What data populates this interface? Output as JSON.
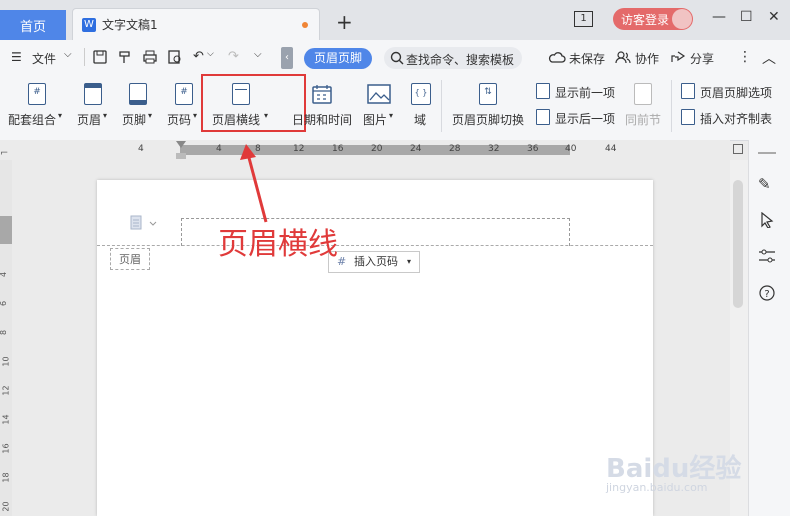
{
  "tabbar": {
    "home_tab": "首页",
    "doc_tab": "文字文稿1",
    "doc_logo": "W",
    "page_count": "1",
    "visitor_login": "访客登录",
    "add_tab_icon": "plus-icon"
  },
  "menu": {
    "file": "文件",
    "hf_label": "页眉页脚",
    "search_placeholder": "查找命令、搜索模板",
    "unsaved": "未保存",
    "collab": "协作",
    "share": "分享"
  },
  "ribbon": {
    "items": [
      {
        "label": "配套组合"
      },
      {
        "label": "页眉"
      },
      {
        "label": "页脚"
      },
      {
        "label": "页码"
      },
      {
        "label": "页眉横线"
      },
      {
        "label": "日期和时间"
      },
      {
        "label": "图片"
      },
      {
        "label": "域"
      },
      {
        "label": "页眉页脚切换"
      }
    ],
    "show_prev": "显示前一项",
    "show_next": "显示后一项",
    "same_as_prev": "同前节",
    "hf_options": "页眉页脚选项",
    "insert_align_tab": "插入对齐制表"
  },
  "ruler": {
    "ticks": [
      "4",
      "4",
      "8",
      "12",
      "16",
      "20",
      "24",
      "28",
      "32",
      "36",
      "40",
      "44"
    ]
  },
  "left_ruler": {
    "ticks": [
      "4",
      "6",
      "8",
      "10",
      "12",
      "14",
      "16",
      "18",
      "20"
    ]
  },
  "doc": {
    "header_label": "页眉",
    "insert_page_number": "插入页码",
    "annotation": "页眉横线"
  },
  "watermark": {
    "logo": "Baidu经验",
    "url": "jingyan.baidu.com"
  },
  "colors": {
    "accent": "#4f86e8",
    "highlight": "#e03a3a",
    "visitor": "#e46a6a"
  }
}
